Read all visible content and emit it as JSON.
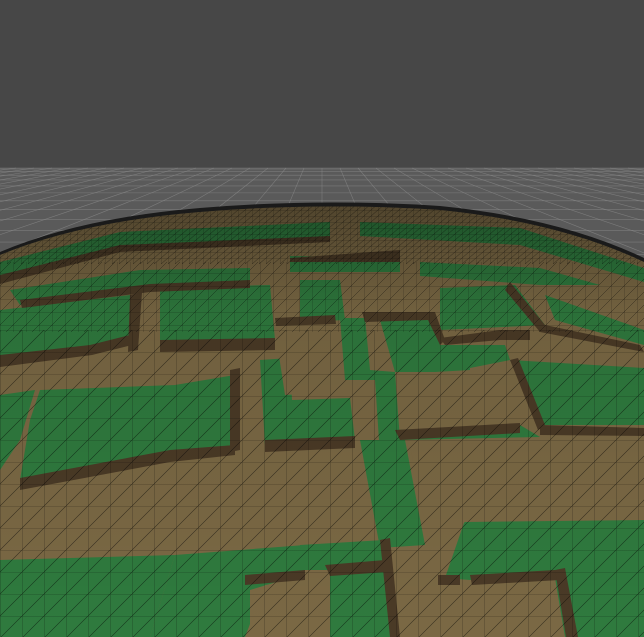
{
  "viewport": {
    "background_color": "#474747",
    "ground_grid_color": "#8a8a8a",
    "ground_plane_color": "#5a5a5a",
    "colors": {
      "grass": "#2f7a3e",
      "grass_dark": "#246231",
      "dirt": "#7a6844",
      "dirt_dark": "#5e5034",
      "wall_side": "#4a3a26",
      "wireframe": "#000000"
    }
  }
}
